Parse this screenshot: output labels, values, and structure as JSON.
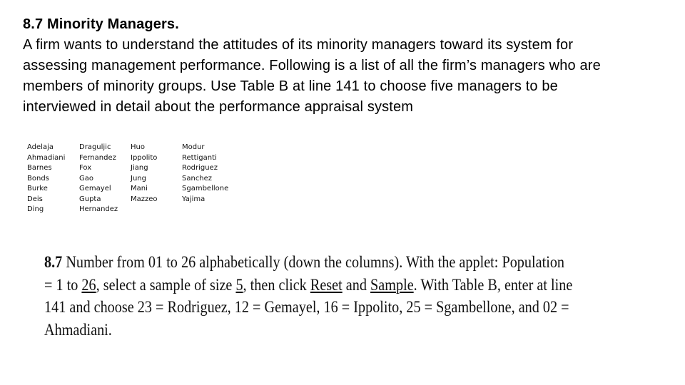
{
  "problem": {
    "title": "8.7 Minority Managers.",
    "body_lines": [
      "A firm wants to understand the attitudes of its minority managers toward its system for",
      "assessing management performance. Following is a list of all the firm’s managers who are",
      "members of minority groups. Use Table B at line 141 to choose five managers to be",
      "interviewed in detail about the performance appraisal system"
    ]
  },
  "managers": {
    "columns": [
      [
        "Adelaja",
        "Ahmadiani",
        "Barnes",
        "Bonds",
        "Burke",
        "Deis",
        "Ding"
      ],
      [
        "Draguljic",
        "Fernandez",
        "Fox",
        "Gao",
        "Gemayel",
        "Gupta",
        "Hernandez"
      ],
      [
        "Huo",
        "Ippolito",
        "Jiang",
        "Jung",
        "Mani",
        "Mazzeo"
      ],
      [
        "Modur",
        "Rettiganti",
        "Rodriguez",
        "Sanchez",
        "Sgambellone",
        "Yajima"
      ]
    ]
  },
  "answer": {
    "number": "8.7",
    "line1_rest": " Number from 01 to 26 alphabetically (down the columns). With the applet: Population",
    "line2_a": "= 1 to ",
    "line2_pop": "26",
    "line2_b": ", select a sample of size ",
    "line2_size": "5",
    "line2_c": ", then click ",
    "line2_reset": "Reset",
    "line2_d": " and ",
    "line2_sample": "Sample",
    "line2_e": ". With Table B, enter at line",
    "line3": "141 and choose 23 = Rodriguez, 12 = Gemayel, 16 = Ippolito, 25 = Sgambellone, and 02 =",
    "line4": "Ahmadiani."
  }
}
